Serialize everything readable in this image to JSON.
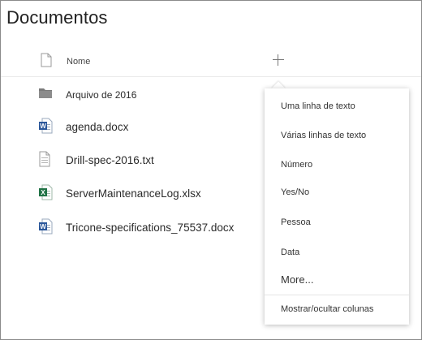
{
  "library": {
    "title": "Documentos"
  },
  "header": {
    "name_label": "Nome",
    "add_column_icon": "plus-icon"
  },
  "files": [
    {
      "name": "Arquivo de 2016",
      "type": "folder",
      "icon": "folder-icon"
    },
    {
      "name": "agenda.docx",
      "type": "docx",
      "icon": "word-doc-icon"
    },
    {
      "name": "Drill-spec-2016.txt",
      "type": "txt",
      "icon": "text-file-icon"
    },
    {
      "name": "ServerMaintenanceLog.xlsx",
      "type": "xlsx",
      "icon": "excel-doc-icon"
    },
    {
      "name": "Tricone-specifications_75537.docx",
      "type": "docx",
      "icon": "word-doc-icon"
    }
  ],
  "column_menu": {
    "items": [
      "Uma linha de texto",
      "Várias linhas de texto",
      "Número",
      "Yes/No",
      "Pessoa",
      "Data"
    ],
    "more_label": "More...",
    "footer_label": "Mostrar/ocultar colunas"
  },
  "colors": {
    "word": "#2b579a",
    "excel": "#217346",
    "folder": "#7a7a7a",
    "text_icon": "#9a9a9a"
  }
}
